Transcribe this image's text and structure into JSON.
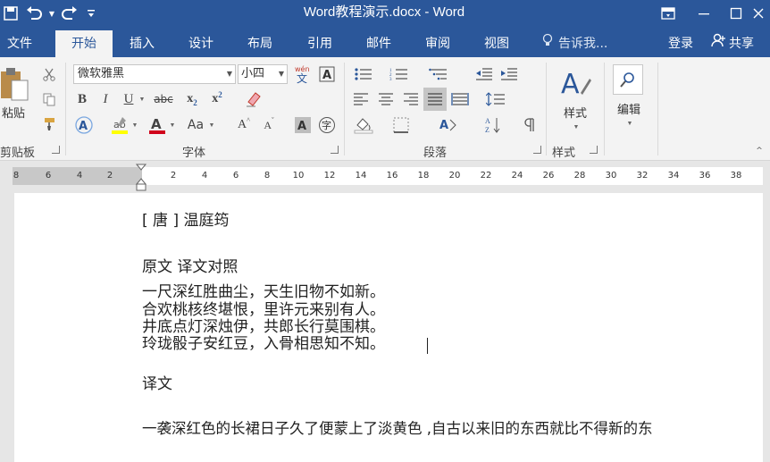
{
  "window": {
    "title": "Word教程演示.docx - Word"
  },
  "tabs": [
    {
      "label": "文件"
    },
    {
      "label": "开始",
      "active": true
    },
    {
      "label": "插入"
    },
    {
      "label": "设计"
    },
    {
      "label": "布局"
    },
    {
      "label": "引用"
    },
    {
      "label": "邮件"
    },
    {
      "label": "审阅"
    },
    {
      "label": "视图"
    }
  ],
  "tell_me": "告诉我...",
  "login": "登录",
  "share": "共享",
  "ribbon": {
    "paste_label": "粘贴",
    "clipboard_label": "剪贴板",
    "font_name": "微软雅黑",
    "font_size": "小四",
    "font_group_label": "字体",
    "paragraph_group_label": "段落",
    "styles_label": "样式",
    "styles_group_label": "样式",
    "edit_label": "编辑"
  },
  "ruler": {
    "numbers": [
      "8",
      "6",
      "4",
      "2",
      "2",
      "4",
      "6",
      "8",
      "10",
      "12",
      "14",
      "16",
      "18",
      "20",
      "22",
      "24",
      "26",
      "28",
      "30",
      "32",
      "34",
      "36",
      "38"
    ]
  },
  "document": {
    "lines": [
      "[ 唐 ] 温庭筠",
      "原文  译文对照",
      "一尺深红胜曲尘，天生旧物不如新。",
      "合欢桃核终堪恨，里许元来别有人。",
      "井底点灯深烛伊，共郎长行莫围棋。",
      "玲珑骰子安红豆，入骨相思知不知。",
      "译文",
      "一袭深红色的长裙日子久了便蒙上了淡黄色 ,自古以来旧的东西就比不得新的东"
    ]
  },
  "colors": {
    "brand": "#2b579a",
    "ribbon_bg": "#f3f3f3",
    "highlight_yellow": "#ffff00",
    "font_color_red": "#d0021b"
  }
}
